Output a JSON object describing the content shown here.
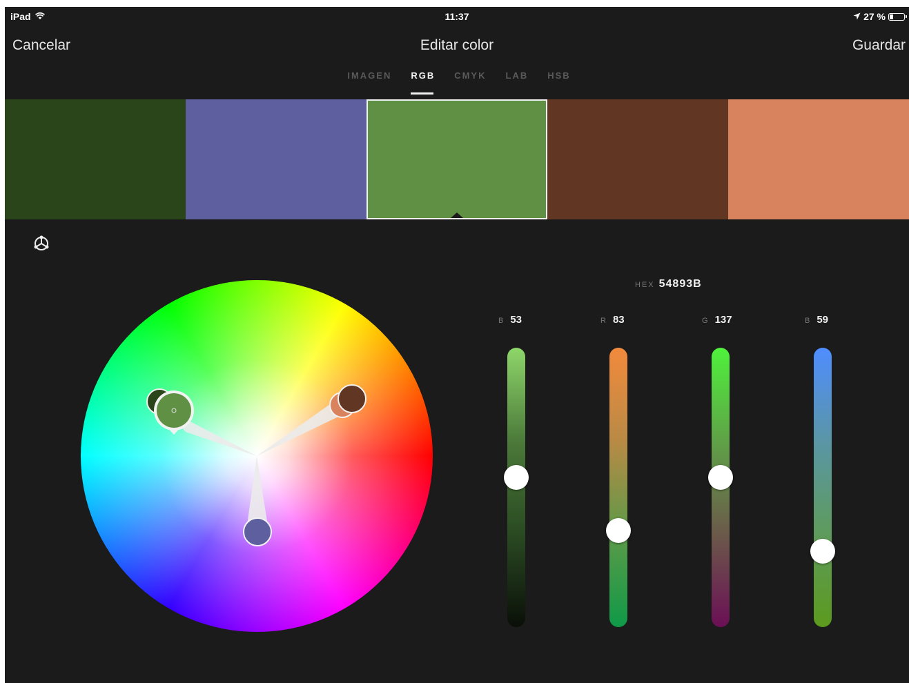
{
  "status_bar": {
    "device": "iPad",
    "time": "11:37",
    "battery": "27 %",
    "battery_level": 0.27
  },
  "nav": {
    "cancel_label": "Cancelar",
    "title": "Editar color",
    "save_label": "Guardar"
  },
  "tabs": [
    {
      "label": "IMAGEN",
      "active": false
    },
    {
      "label": "RGB",
      "active": true
    },
    {
      "label": "CMYK",
      "active": false
    },
    {
      "label": "LAB",
      "active": false
    },
    {
      "label": "HSB",
      "active": false
    }
  ],
  "swatches": [
    {
      "color": "#2a4519",
      "selected": false
    },
    {
      "color": "#5d5f9e",
      "selected": false
    },
    {
      "color": "#5f9044",
      "selected": true
    },
    {
      "color": "#613724",
      "selected": false
    },
    {
      "color": "#d8835e",
      "selected": false
    }
  ],
  "hex": {
    "label": "HEX",
    "value": "54893B"
  },
  "channels": [
    {
      "label": "B",
      "value": "53",
      "level": 0.54,
      "gradient": [
        "#8ed66a",
        "#4c7a3a",
        "#2a4a22",
        "#0a0f08"
      ]
    },
    {
      "label": "R",
      "value": "83",
      "level": 0.33,
      "gradient": [
        "#f28a3c",
        "#b98a45",
        "#5c9a48",
        "#0f9a48"
      ]
    },
    {
      "label": "G",
      "value": "137",
      "level": 0.54,
      "gradient": [
        "#4ff23c",
        "#5fa247",
        "#6b5a4a",
        "#6b0f55"
      ]
    },
    {
      "label": "B",
      "value": "59",
      "level": 0.25,
      "gradient": [
        "#4f8dff",
        "#5a96a6",
        "#5e9b5c",
        "#5c9a1e"
      ]
    }
  ],
  "icons": {
    "harmony": "harmony-rule-icon",
    "wifi": "wifi-icon",
    "location": "location-arrow-icon",
    "battery": "battery-icon"
  }
}
